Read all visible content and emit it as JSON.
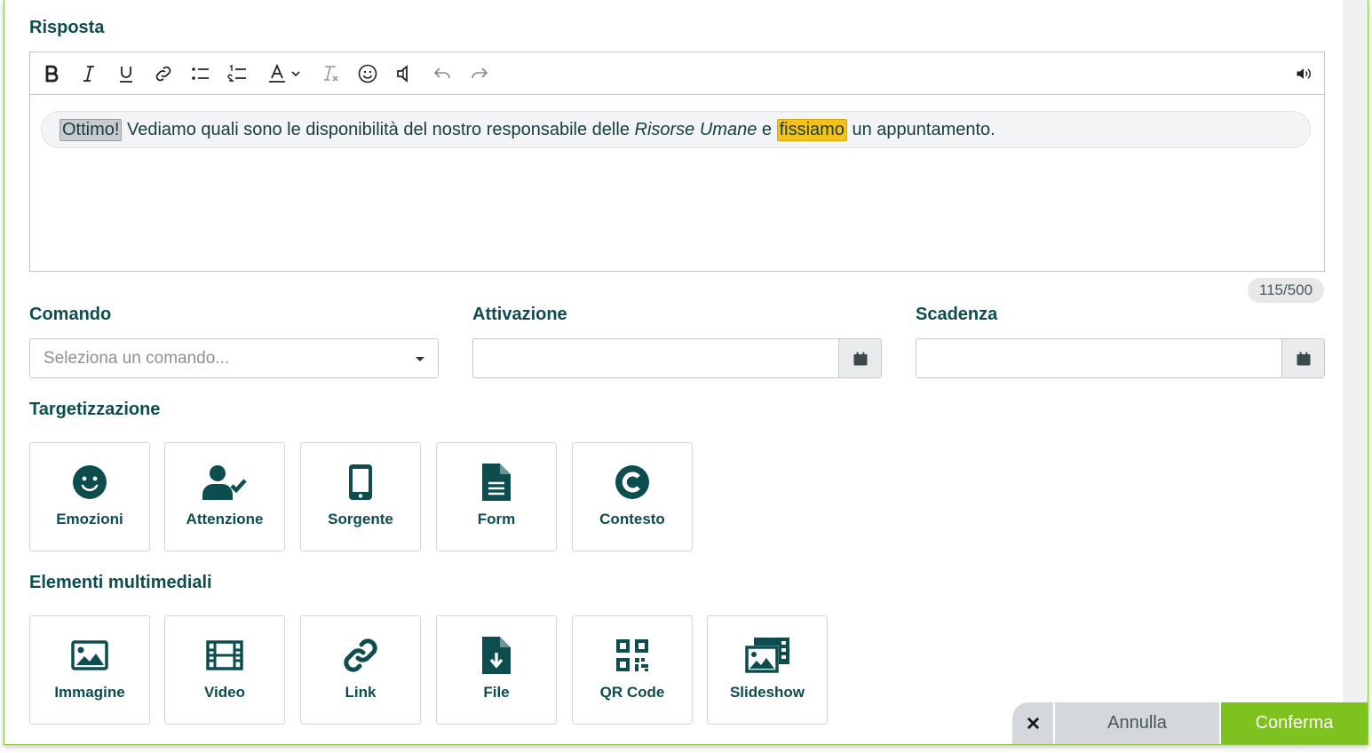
{
  "labels": {
    "risposta": "Risposta",
    "comando": "Comando",
    "attivazione": "Attivazione",
    "scadenza": "Scadenza",
    "targetizzazione": "Targetizzazione",
    "multimedia": "Elementi multimediali"
  },
  "editor": {
    "toolbar": [
      "bold-icon",
      "italic-icon",
      "underline-icon",
      "link-icon",
      "bullet-list-icon",
      "numbered-list-icon",
      "text-color-icon",
      "chevron-down-icon",
      "clear-format-icon",
      "emoji-icon",
      "speaker-icon",
      "undo-icon",
      "redo-icon",
      "audio-icon"
    ],
    "message": {
      "hl1": "Ottimo!",
      "t1": " Vediamo quali sono le disponibilità del nostro responsabile delle ",
      "italic": "Risorse Umane",
      "t2": " e ",
      "hl2": "fissiamo",
      "t3": " un appuntamento."
    },
    "counter": "115/500"
  },
  "comando": {
    "placeholder": "Seleziona un comando..."
  },
  "targeting": {
    "items": [
      {
        "label": "Emozioni",
        "icon": "smiley-icon"
      },
      {
        "label": "Attenzione",
        "icon": "user-check-icon"
      },
      {
        "label": "Sorgente",
        "icon": "mobile-icon"
      },
      {
        "label": "Form",
        "icon": "document-icon"
      },
      {
        "label": "Contesto",
        "icon": "context-icon"
      }
    ]
  },
  "multimedia": {
    "items": [
      {
        "label": "Immagine",
        "icon": "image-icon"
      },
      {
        "label": "Video",
        "icon": "film-icon"
      },
      {
        "label": "Link",
        "icon": "link-icon"
      },
      {
        "label": "File",
        "icon": "file-download-icon"
      },
      {
        "label": "QR Code",
        "icon": "qrcode-icon"
      },
      {
        "label": "Slideshow",
        "icon": "slideshow-icon"
      }
    ]
  },
  "footer": {
    "cancel": "Annulla",
    "confirm": "Conferma"
  },
  "colors": {
    "accent": "#0d4d4f",
    "confirm": "#7dc21e",
    "highlight": "#f5c21b"
  }
}
